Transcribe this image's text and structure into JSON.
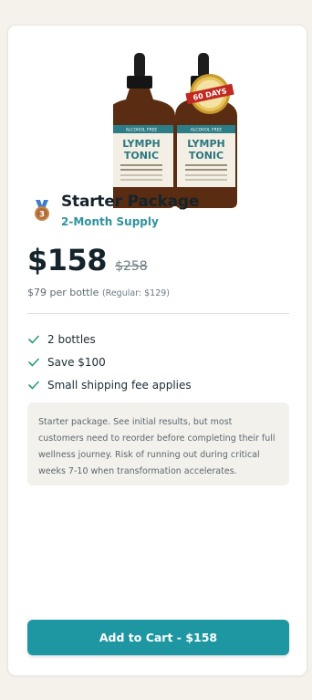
{
  "product": {
    "image_alt": "Lymph Tonic bottles",
    "bottle_label_top": "ALCOHOL FREE",
    "bottle_name_line1": "LYMPH",
    "bottle_name_line2": "TONIC",
    "badge_text": "60 DAYS"
  },
  "package": {
    "icon": "bronze-medal-icon",
    "medal_number": "3",
    "title": "Starter Package",
    "subtitle": "2-Month Supply"
  },
  "pricing": {
    "price": "$158",
    "old_price": "$258",
    "per_bottle": "$79 per bottle",
    "regular": "(Regular: $129)"
  },
  "features": [
    {
      "icon": "check-icon",
      "text": "2 bottles"
    },
    {
      "icon": "check-icon",
      "text": "Save $100"
    },
    {
      "icon": "check-icon",
      "text": "Small shipping fee applies"
    }
  ],
  "note": "Starter package. See initial results, but most customers need to reorder before completing their full wellness journey. Risk of running out during critical weeks 7-10 when transformation accelerates.",
  "cart_button": {
    "label": "Add to Cart - $158"
  },
  "colors": {
    "accent": "#1e97a3",
    "subtitle": "#2f93a0",
    "check": "#2a9d7c",
    "background": "#f5f2ec"
  }
}
